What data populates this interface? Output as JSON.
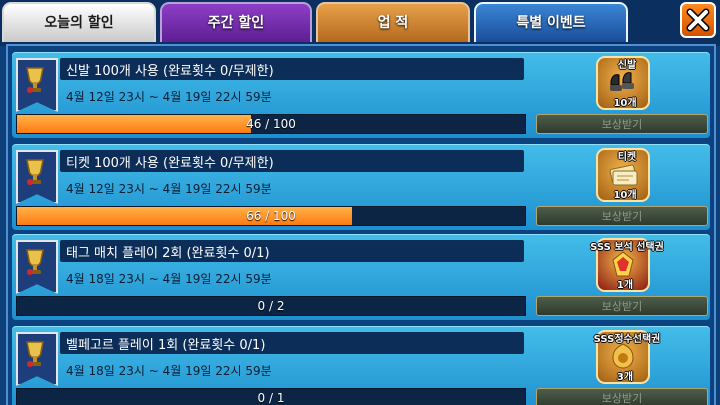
{
  "tabs": {
    "today": "오늘의 할인",
    "weekly": "주간 할인",
    "achievement": "업 적",
    "special_event": "특별 이벤트"
  },
  "tabs_active": "special_event",
  "claim_label": "보상받기",
  "events": [
    {
      "title": "신발 100개 사용 (완료횟수 0/무제한)",
      "date": "4월 12일 23시 ~ 4월 19일 22시 59분",
      "progress_text": "46 / 100",
      "progress": 0.46,
      "reward_name": "신발",
      "reward_qty": "10개",
      "reward_icon": "shoes-icon"
    },
    {
      "title": "티켓 100개 사용 (완료횟수 0/무제한)",
      "date": "4월 12일 23시 ~ 4월 19일 22시 59분",
      "progress_text": "66 / 100",
      "progress": 0.66,
      "reward_name": "티켓",
      "reward_qty": "10개",
      "reward_icon": "ticket-icon"
    },
    {
      "title": "태그 매치 플레이 2회 (완료횟수 0/1)",
      "date": "4월 18일 23시 ~ 4월 19일 22시 59분",
      "progress_text": "0 / 2",
      "progress": 0,
      "reward_name": "SSS 보석 선택권",
      "reward_qty": "1개",
      "reward_icon": "gem-voucher-icon"
    },
    {
      "title": "벨페고르 플레이 1회 (완료횟수 0/1)",
      "date": "4월 18일 23시 ~ 4월 19일 22시 59분",
      "progress_text": "0 / 1",
      "progress": 0,
      "reward_name": "SSS정수선택권",
      "reward_qty": "3개",
      "reward_icon": "essence-voucher-icon"
    }
  ],
  "colors": {
    "progress_fill": "#ff8a1f",
    "row_bg": "#2aa3dc",
    "tab_event": "#2a6cc0",
    "tab_weekly": "#7a2fb0",
    "tab_achievement": "#d08833"
  }
}
